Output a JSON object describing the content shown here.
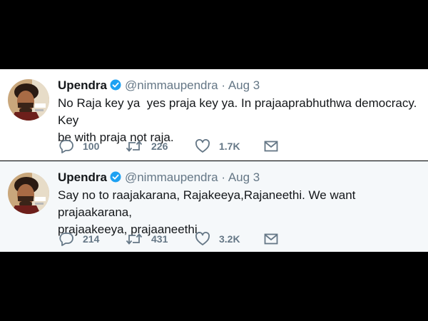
{
  "tweets": [
    {
      "display_name": "Upendra",
      "handle": "@nimmaupendra",
      "separator": "·",
      "date": "Aug 3",
      "text": "No Raja key ya  yes praja key ya. In prajaaprabhuthwa democracy. Key\nbe with praja not raja.",
      "reply_count": "100",
      "retweet_count": "226",
      "like_count": "1.7K",
      "avatar_icon": "profile-photo",
      "verified_icon": "verified-badge-icon"
    },
    {
      "display_name": "Upendra",
      "handle": "@nimmaupendra",
      "separator": "·",
      "date": "Aug 3",
      "text": "Say no to raajakarana, Rajakeeya,Rajaneethi. We want prajaakarana,\nprajaakeeya, prajaaneethi.",
      "reply_count": "214",
      "retweet_count": "431",
      "like_count": "3.2K",
      "avatar_icon": "profile-photo",
      "verified_icon": "verified-badge-icon"
    }
  ],
  "colors": {
    "letterbox": "#000000",
    "text_primary": "#14171a",
    "text_secondary": "#657786",
    "verified": "#1da1f2",
    "tweet_bg_1": "#ffffff",
    "tweet_bg_2": "#f5f8fa"
  },
  "icons": {
    "reply": "reply-icon",
    "retweet": "retweet-icon",
    "like": "like-icon",
    "direct_message": "direct-message-icon"
  }
}
